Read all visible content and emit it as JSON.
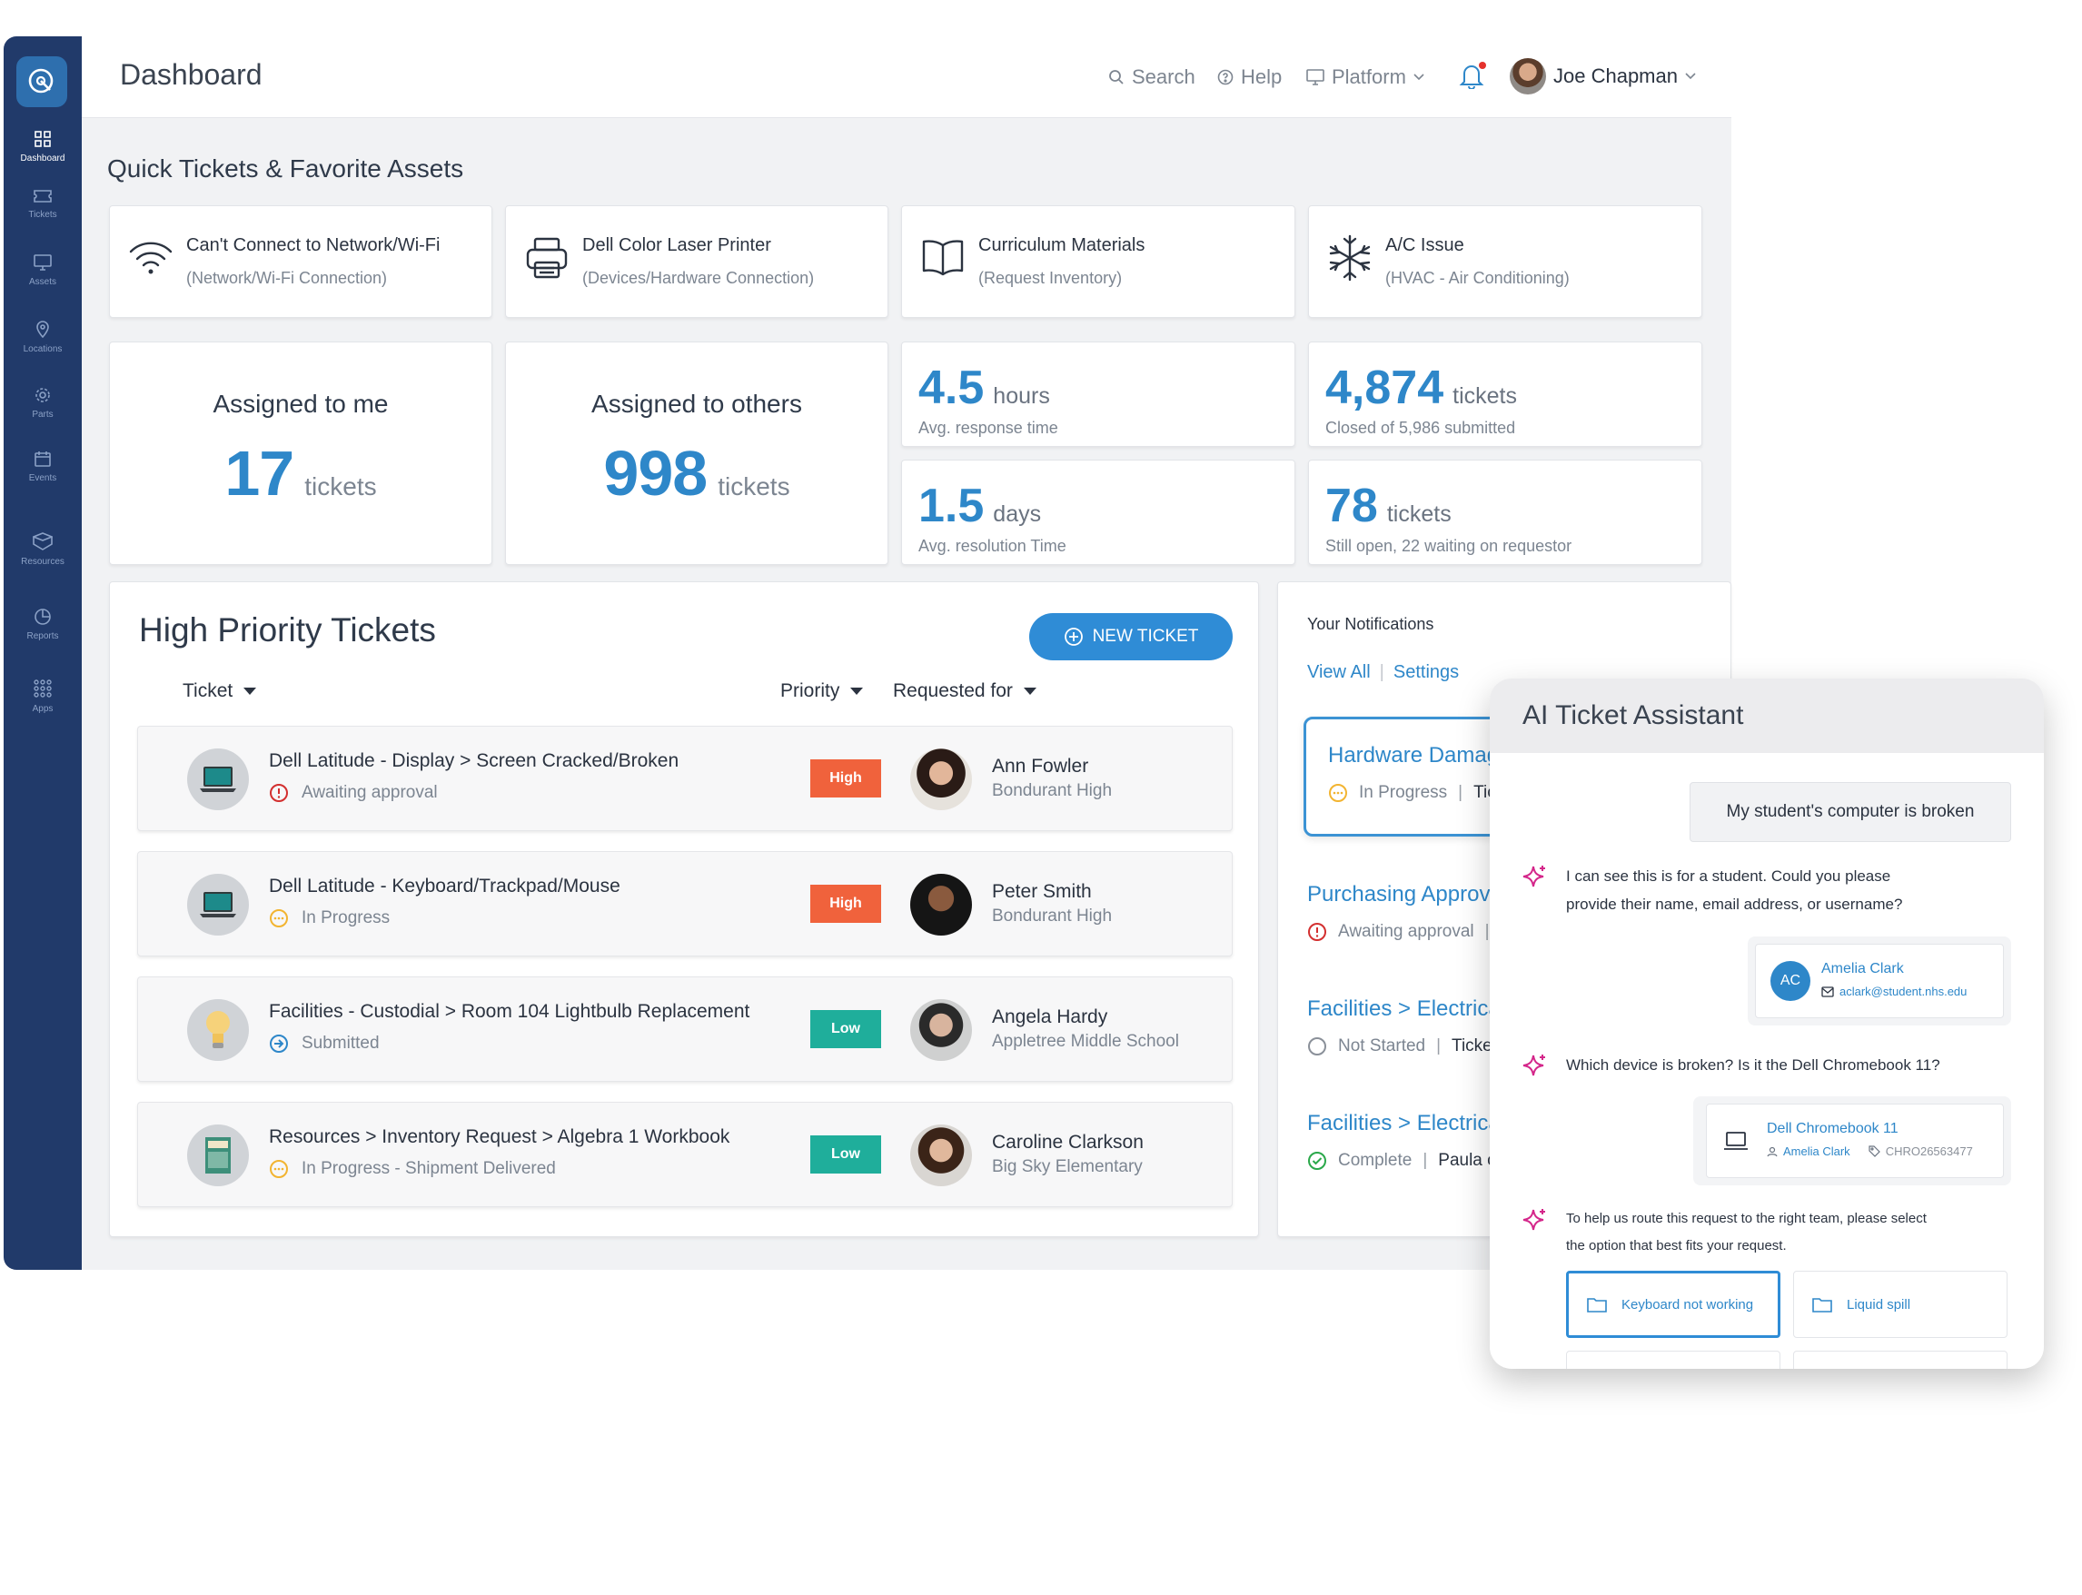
{
  "sidebar": {
    "items": [
      {
        "label": "Dashboard",
        "icon": "grid-icon"
      },
      {
        "label": "Tickets",
        "icon": "ticket-icon"
      },
      {
        "label": "Assets",
        "icon": "monitor-icon"
      },
      {
        "label": "Locations",
        "icon": "pin-icon"
      },
      {
        "label": "Parts",
        "icon": "gear-icon"
      },
      {
        "label": "Events",
        "icon": "calendar-icon"
      },
      {
        "label": "Resources",
        "icon": "box-icon"
      },
      {
        "label": "Reports",
        "icon": "pie-icon"
      },
      {
        "label": "Apps",
        "icon": "apps-icon"
      }
    ]
  },
  "header": {
    "title": "Dashboard",
    "search": "Search",
    "help": "Help",
    "platform": "Platform",
    "user": "Joe Chapman"
  },
  "quick": {
    "title": "Quick Tickets & Favorite Assets",
    "items": [
      {
        "title": "Can't Connect to Network/Wi-Fi",
        "sub": "(Network/Wi-Fi Connection)"
      },
      {
        "title": "Dell Color Laser Printer",
        "sub": "(Devices/Hardware Connection)"
      },
      {
        "title": "Curriculum Materials",
        "sub": "(Request Inventory)"
      },
      {
        "title": "A/C Issue",
        "sub": "(HVAC - Air Conditioning)"
      }
    ]
  },
  "stats": {
    "assigned_me": {
      "label": "Assigned to me",
      "value": "17",
      "unit": "tickets"
    },
    "assigned_others": {
      "label": "Assigned to others",
      "value": "998",
      "unit": "tickets"
    },
    "response": {
      "value": "4.5",
      "unit": "hours",
      "sub": "Avg. response time"
    },
    "closed": {
      "value": "4,874",
      "unit": "tickets",
      "sub": "Closed of 5,986 submitted"
    },
    "resolution": {
      "value": "1.5",
      "unit": "days",
      "sub": "Avg. resolution Time"
    },
    "open": {
      "value": "78",
      "unit": "tickets",
      "sub": "Still open, 22 waiting on requestor"
    }
  },
  "tickets": {
    "title": "High Priority Tickets",
    "new_button": "NEW TICKET",
    "columns": {
      "ticket": "Ticket",
      "priority": "Priority",
      "requested": "Requested for"
    },
    "rows": [
      {
        "title": "Dell Latitude - Display > Screen Cracked/Broken",
        "status": "Awaiting approval",
        "priority": "High",
        "name": "Ann Fowler",
        "org": "Bondurant High"
      },
      {
        "title": "Dell Latitude - Keyboard/Trackpad/Mouse",
        "status": "In Progress",
        "priority": "High",
        "name": "Peter Smith",
        "org": "Bondurant High"
      },
      {
        "title": "Facilities - Custodial > Room 104 Lightbulb Replacement",
        "status": "Submitted",
        "priority": "Low",
        "name": "Angela Hardy",
        "org": "Appletree Middle School"
      },
      {
        "title": "Resources > Inventory Request > Algebra 1 Workbook",
        "status": "In Progress - Shipment Delivered",
        "priority": "Low",
        "name": "Caroline Clarkson",
        "org": "Big Sky Elementary"
      }
    ]
  },
  "notifications": {
    "title": "Your Notifications",
    "view_all": "View All",
    "settings": "Settings",
    "items": [
      {
        "title": "Hardware Damage",
        "status": "In Progress",
        "extra": "Tick"
      },
      {
        "title": "Purchasing Approva",
        "status": "Awaiting approval",
        "extra": ""
      },
      {
        "title": "Facilities > Electrical",
        "status": "Not Started",
        "extra": "Ticket"
      },
      {
        "title": "Facilities > Electrical",
        "status": "Complete",
        "extra": "Paula c"
      }
    ]
  },
  "ai": {
    "title": "AI Ticket Assistant",
    "user_msg": "My student's computer is broken",
    "msg1a": "I can see this is for a student. Could you please",
    "msg1b": "provide their name, email address, or username?",
    "student": {
      "initials": "AC",
      "name": "Amelia Clark",
      "email": "aclark@student.nhs.edu"
    },
    "msg2": "Which device is broken? Is it the Dell Chromebook 11?",
    "device": {
      "name": "Dell Chromebook 11",
      "owner": "Amelia Clark",
      "tag": "CHRO26563477"
    },
    "msg3a": "To help us route this request to the right team, please select",
    "msg3b": "the option that best fits your request.",
    "options": [
      "Keyboard not working",
      "Liquid spill"
    ]
  },
  "colors": {
    "accent": "#2e87c9",
    "sidebar": "#213a6a",
    "high": "#f0623c",
    "low": "#1fae9b",
    "ai_spark": "#d4268a"
  }
}
